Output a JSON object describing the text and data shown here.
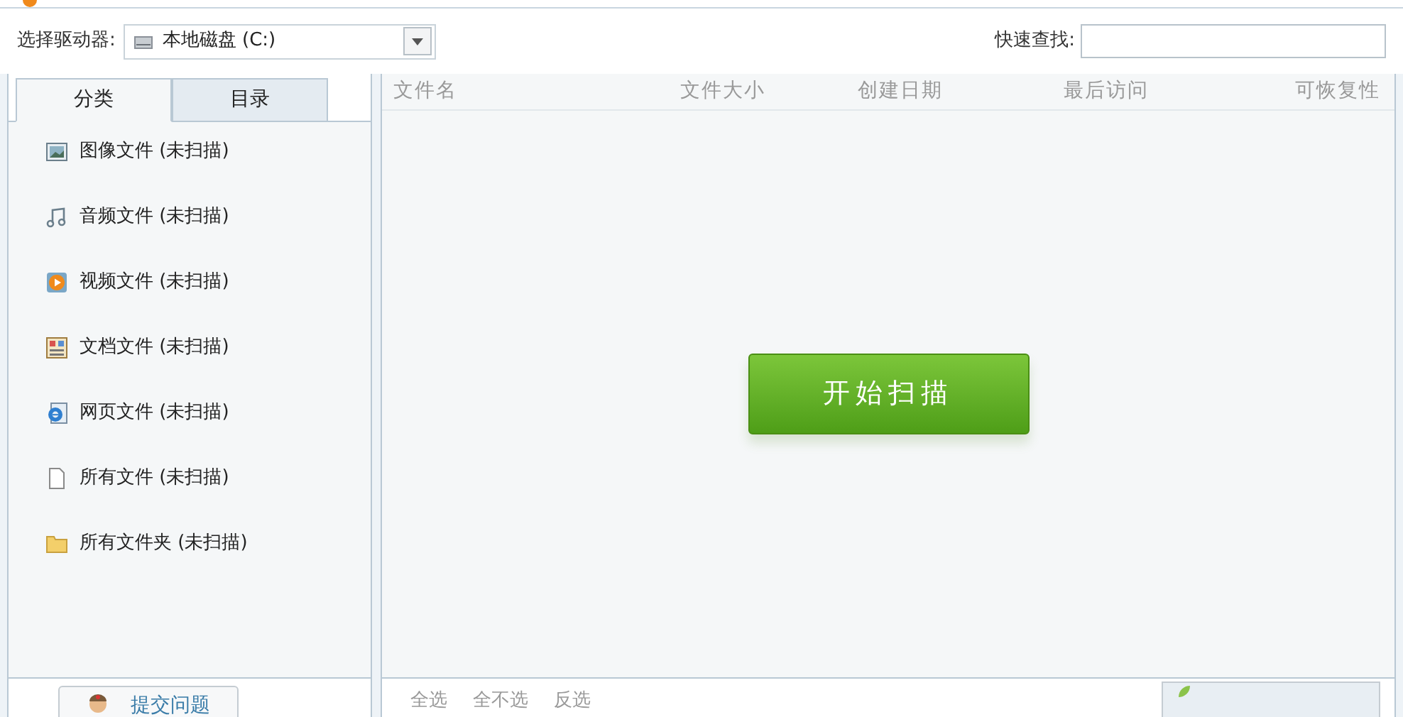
{
  "toolbar": {
    "drive_label": "选择驱动器:",
    "drive_value": "本地磁盘 (C:)",
    "search_label": "快速查找:"
  },
  "tabs": [
    {
      "label": "分类",
      "selected": true
    },
    {
      "label": "目录",
      "selected": false
    }
  ],
  "categories": [
    {
      "kind": "image",
      "label": "图像文件 (未扫描)"
    },
    {
      "kind": "audio",
      "label": "音频文件 (未扫描)"
    },
    {
      "kind": "video",
      "label": "视频文件 (未扫描)"
    },
    {
      "kind": "document",
      "label": "文档文件 (未扫描)"
    },
    {
      "kind": "web",
      "label": "网页文件 (未扫描)"
    },
    {
      "kind": "file",
      "label": "所有文件 (未扫描)"
    },
    {
      "kind": "folder",
      "label": "所有文件夹 (未扫描)"
    }
  ],
  "table": {
    "columns": [
      "文件名",
      "文件大小",
      "创建日期",
      "最后访问",
      "可恢复性"
    ]
  },
  "scan_button": "开始扫描",
  "feedback_button": "提交问题",
  "selection_links": [
    "全选",
    "全不选",
    "反选"
  ]
}
